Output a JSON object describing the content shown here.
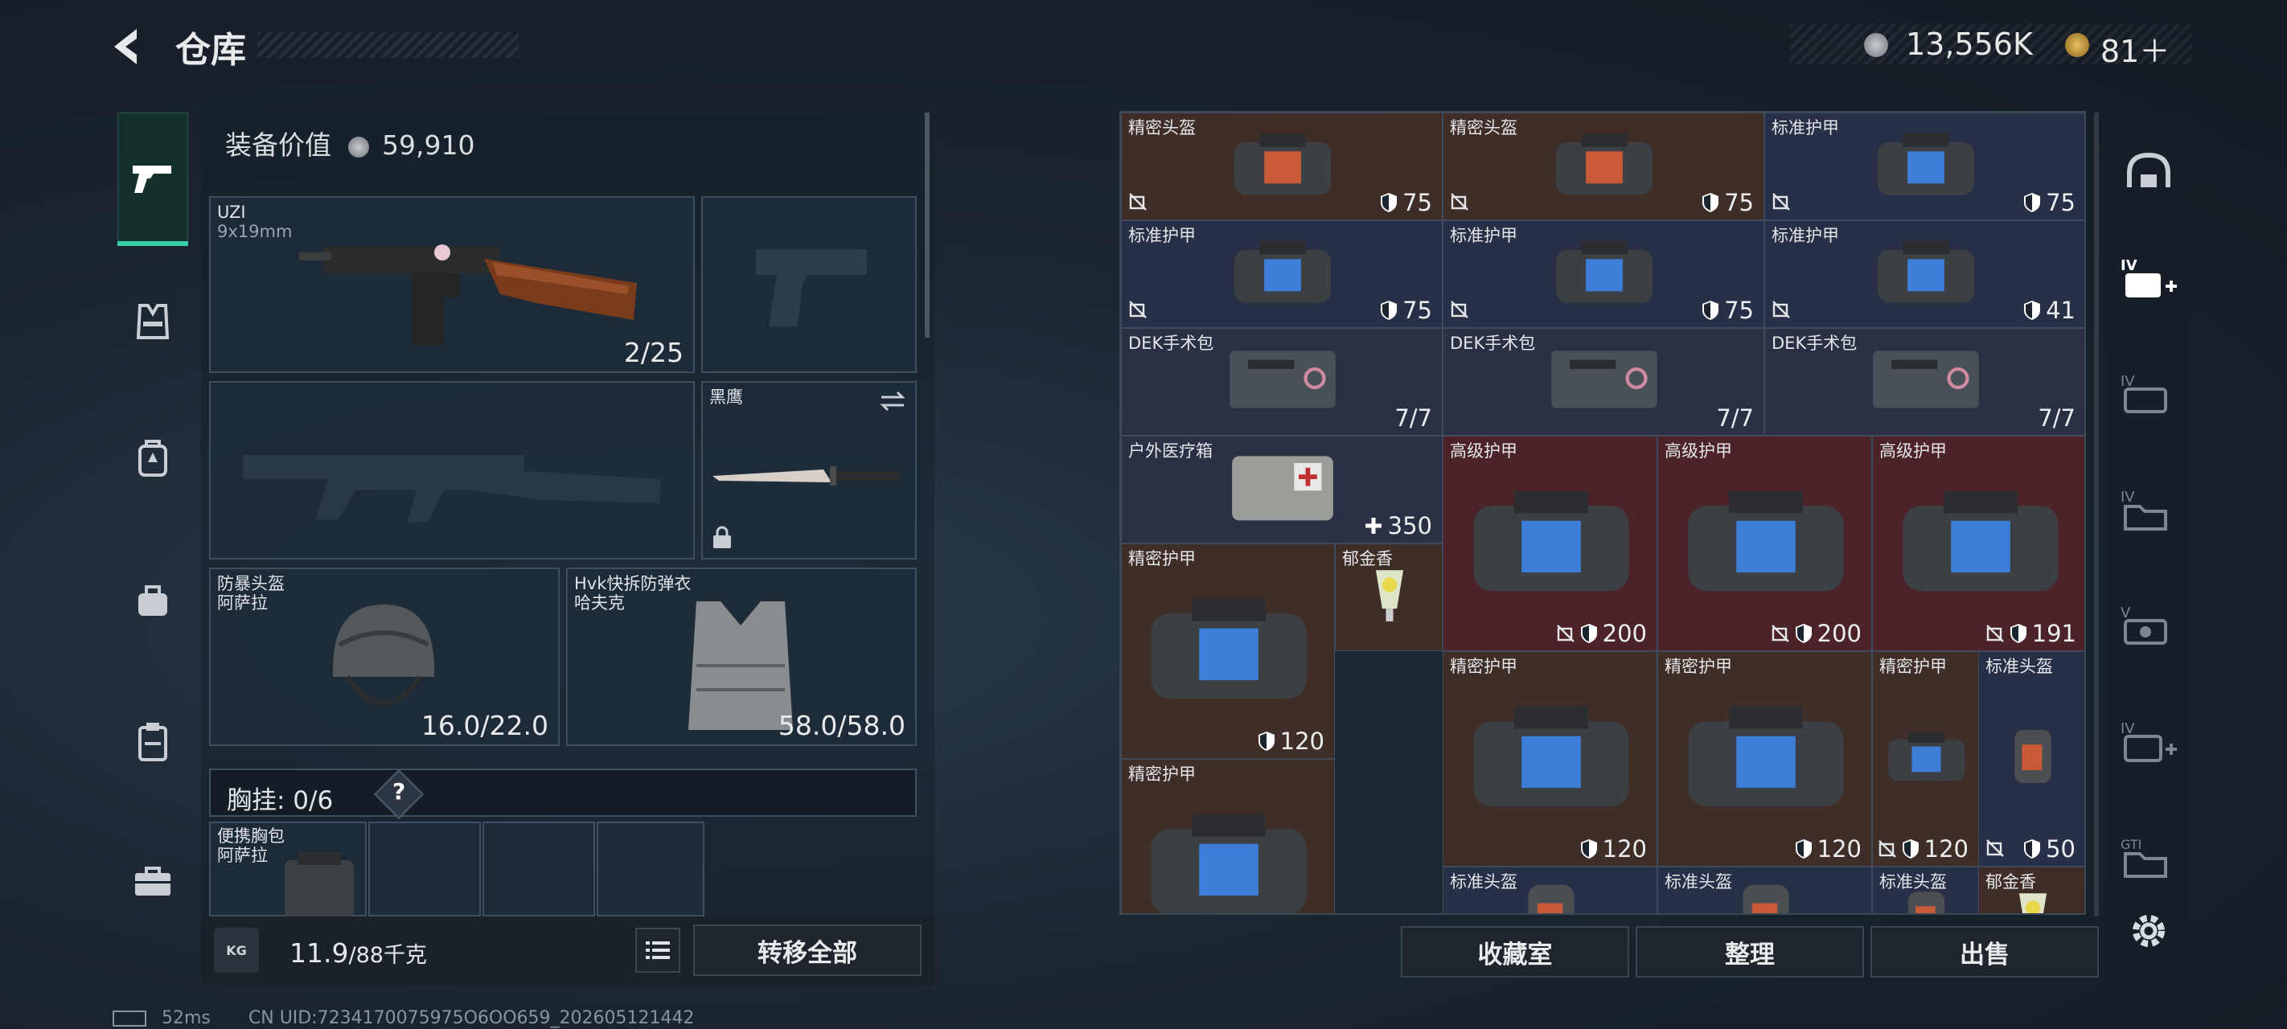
{
  "header": {
    "title": "仓库",
    "currency_silver": "13,556K",
    "currency_gold": "81＋"
  },
  "left_rail": [
    "pistol-icon",
    "vest-rig-icon",
    "backpack-icon",
    "bag-icon",
    "clipboard-icon",
    "toolbox-icon"
  ],
  "loadout": {
    "equip_value_label": "装备价值",
    "equip_value": "59,910",
    "primary": {
      "name": "UZI",
      "caliber": "9x19mm",
      "ammo": "2/25"
    },
    "melee": {
      "name": "黑鹰"
    },
    "helmet": {
      "line1": "防暴头盔",
      "line2": "阿萨拉",
      "durability": "16.0/22.0"
    },
    "armor": {
      "line1": "Hvk快拆防弹衣",
      "line2": "哈夫克",
      "durability": "58.0/58.0"
    },
    "chest_rig": {
      "label": "胸挂: 0/6",
      "help": "?"
    },
    "pouch": {
      "line1": "便携胸包",
      "line2": "阿萨拉"
    },
    "weight": {
      "current": "11.9",
      "max": "/88千克",
      "badge": "KG"
    },
    "transfer_all": "转移全部"
  },
  "stash": {
    "items": [
      {
        "name": "精密头盔",
        "value": "75",
        "tone": "brown"
      },
      {
        "name": "精密头盔",
        "value": "75",
        "tone": "brown"
      },
      {
        "name": "标准护甲",
        "value": "75",
        "tone": "blue"
      },
      {
        "name": "标准护甲",
        "value": "75",
        "tone": "blue"
      },
      {
        "name": "标准护甲",
        "value": "75",
        "tone": "blue"
      },
      {
        "name": "标准护甲",
        "value": "41",
        "tone": "blue"
      },
      {
        "name": "DEK手术包",
        "value": "7/7",
        "tone": "slate"
      },
      {
        "name": "DEK手术包",
        "value": "7/7",
        "tone": "slate"
      },
      {
        "name": "DEK手术包",
        "value": "7/7",
        "tone": "slate"
      },
      {
        "name": "户外医疗箱",
        "value": "350",
        "tone": "slate"
      },
      {
        "name": "高级护甲",
        "value": "200",
        "tone": "red"
      },
      {
        "name": "高级护甲",
        "value": "200",
        "tone": "red"
      },
      {
        "name": "高级护甲",
        "value": "191",
        "tone": "red"
      },
      {
        "name": "精密护甲",
        "value": "120",
        "tone": "brown"
      },
      {
        "name": "郁金香",
        "value": "",
        "tone": "brown"
      },
      {
        "name": "精密护甲",
        "value": "120",
        "tone": "brown"
      },
      {
        "name": "精密护甲",
        "value": "120",
        "tone": "brown"
      },
      {
        "name": "精密护甲",
        "value": "120",
        "tone": "brown"
      },
      {
        "name": "标准头盔",
        "value": "50",
        "tone": "blue"
      },
      {
        "name": "精密护甲",
        "value": "",
        "tone": "brown"
      },
      {
        "name": "标准头盔",
        "value": "",
        "tone": "blue"
      },
      {
        "name": "标准头盔",
        "value": "",
        "tone": "blue"
      },
      {
        "name": "标准头盔",
        "value": "",
        "tone": "blue"
      },
      {
        "name": "郁金香",
        "value": "",
        "tone": "brown"
      }
    ],
    "buttons": {
      "collection": "收藏室",
      "sort": "整理",
      "sell": "出售"
    }
  },
  "right_rail": [
    "helmet-filter-icon",
    "iv-medkit-icon",
    "iv-ammo-icon",
    "iv-folder-icon",
    "v-eye-icon",
    "iv-plus-icon",
    "gti-folder-icon",
    "settings-gear-icon"
  ],
  "status": {
    "ping": "52ms",
    "uid": "CN UID:7234170075975O6OO659_202605121442"
  },
  "colors": {
    "accent": "#35d0a6",
    "red_tier": "#4b2328",
    "brown_tier": "#3f2d27",
    "blue_tier": "#273047"
  }
}
